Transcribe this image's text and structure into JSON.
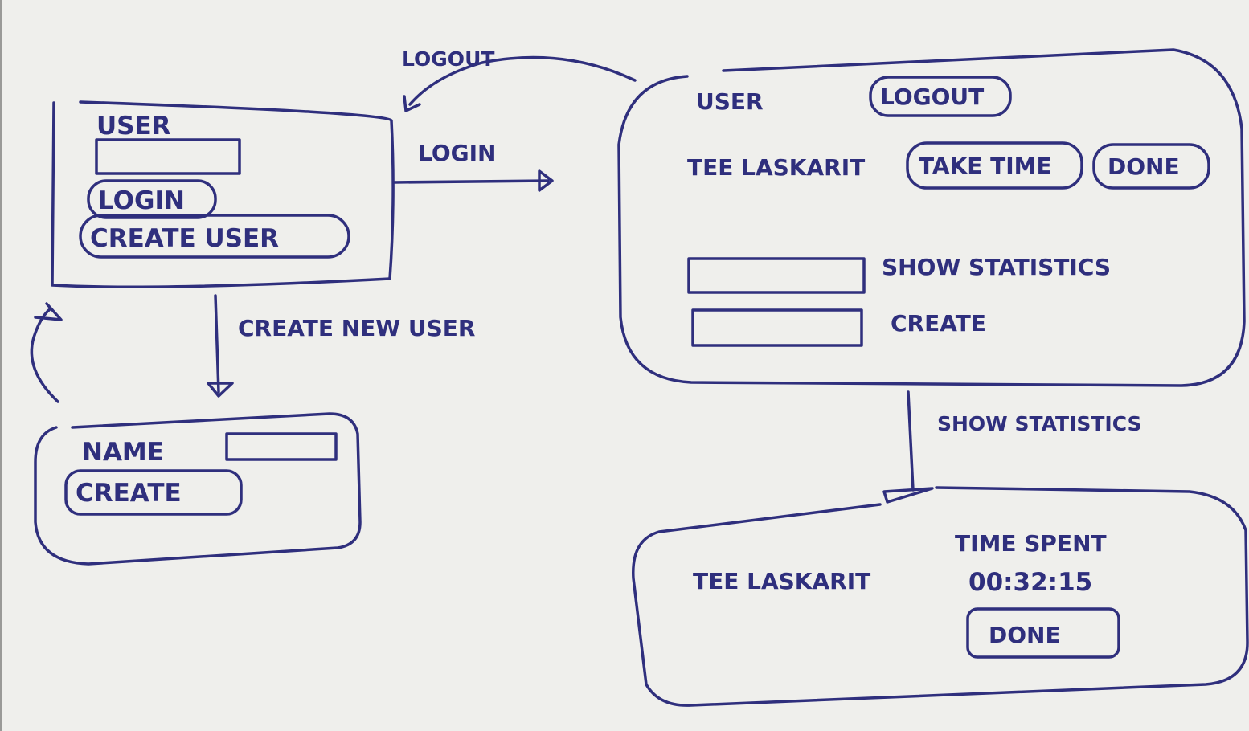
{
  "login_screen": {
    "user_label": "USER",
    "login_button": "LOGIN",
    "create_user_button": "CREATE USER"
  },
  "create_user_screen": {
    "name_label": "NAME",
    "create_button": "CREATE"
  },
  "main_screen": {
    "user_label": "USER",
    "logout_button": "LOGOUT",
    "task_label": "TEE LASKARIT",
    "take_time_button": "TAKE TIME",
    "done_button": "DONE",
    "show_statistics_label": "SHOW STATISTICS",
    "create_label": "CREATE"
  },
  "statistics_screen": {
    "task_label": "TEE LASKARIT",
    "time_spent_label": "TIME SPENT",
    "time_value": "00:32:15",
    "done_button": "DONE"
  },
  "transitions": {
    "logout": "LOGOUT",
    "login": "LOGIN",
    "create_new_user": "CREATE NEW USER",
    "show_statistics": "SHOW STATISTICS"
  }
}
